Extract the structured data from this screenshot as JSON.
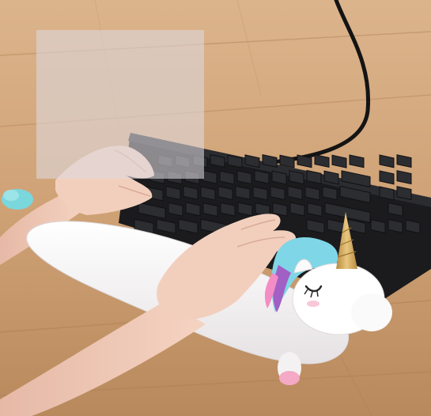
{
  "scene": {
    "colors": {
      "wood_light": "#d9b086",
      "wood_mid": "#c79a6e",
      "wood_dark": "#9c6e48",
      "keyboard": "#1b1b1d",
      "key": "#2a2b2e",
      "cable": "#141414",
      "skin": "#f2cfbd",
      "skin_shadow": "#d9ab97",
      "plush": "#fbfafa",
      "plush_shadow": "#e3e0e2",
      "mane_blue": "#7fd6e6",
      "mane_purple": "#a25fc4",
      "mane_pink": "#f48cc5",
      "horn": "#d2a85a",
      "tail_blue": "#7ad7dc",
      "cheek": "#f7b0c8"
    },
    "objects": [
      "wooden-floor",
      "mechanical-keyboard",
      "keyboard-cable",
      "unicorn-plush-wrist-rest",
      "left-hand",
      "right-hand"
    ]
  }
}
